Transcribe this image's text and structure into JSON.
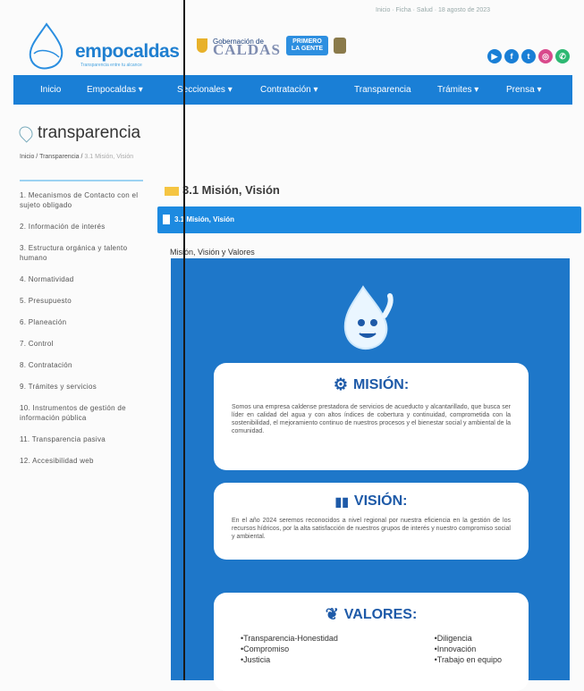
{
  "topbar": {
    "text": "Inicio · Ficha · Salud · 18 agosto de 2023"
  },
  "header": {
    "logo_name": "empocaldas",
    "logo_tagline": "Transparencia entre tu alcance",
    "gov_label": "Gobernación de",
    "gov_name": "CALDAS",
    "gov_badge_line1": "PRIMERO",
    "gov_badge_line2": "LA GENTE"
  },
  "social": [
    {
      "icon": "youtube-icon",
      "glyph": "▶",
      "color": "#1a7fd6"
    },
    {
      "icon": "facebook-icon",
      "glyph": "f",
      "color": "#1a7fd6"
    },
    {
      "icon": "twitter-icon",
      "glyph": "t",
      "color": "#1a7fd6"
    },
    {
      "icon": "instagram-icon",
      "glyph": "◎",
      "color": "#d94a8c"
    },
    {
      "icon": "whatsapp-icon",
      "glyph": "✆",
      "color": "#2eb872"
    }
  ],
  "nav": {
    "items": [
      "Inicio",
      "Empocaldas ▾",
      "Seccionales ▾",
      "Contratación ▾",
      "Transparencia",
      "Trámites ▾",
      "Prensa ▾"
    ]
  },
  "page": {
    "title": "transparencia",
    "breadcrumb": [
      "Inicio",
      "Transparencia",
      "3.1 Misión, Visión"
    ]
  },
  "sidebar": {
    "items": [
      "1. Mecanismos de Contacto con el sujeto obligado",
      "2. Información de interés",
      "3. Estructura orgánica y talento humano",
      "4. Normatividad",
      "5. Presupuesto",
      "6. Planeación",
      "7. Control",
      "8. Contratación",
      "9. Trámites y servicios",
      "10. Instrumentos de gestión de información pública",
      "11. Transparencia pasiva",
      "12. Accesibilidad web"
    ]
  },
  "content": {
    "section_title": "3.1 Misión, Visión",
    "panel_title": "3.1 Misión, Visión",
    "subtitle": "Misión, Visión y Valores",
    "mision": {
      "title": "MISIÓN:",
      "text": "Somos una empresa caldense prestadora de servicios de acueducto y alcantarillado, que busca ser líder en calidad del agua y con altos índices de cobertura y continuidad, comprometida con la sostenibilidad, el mejoramiento continuo de nuestros procesos y el bienestar social y ambiental de la comunidad."
    },
    "vision": {
      "title": "VISIÓN:",
      "text": "En el año 2024 seremos reconocidos a nivel regional por nuestra eficiencia en la gestión de los recursos hídricos, por la alta satisfacción de nuestros grupos de interés y nuestro compromiso social y ambiental."
    },
    "valores": {
      "title": "VALORES:",
      "left": [
        "•Transparencia-Honestidad",
        "•Compromiso",
        "•Justicia"
      ],
      "right": [
        "•Diligencia",
        "•Innovación",
        "•Trabajo en equipo"
      ]
    }
  }
}
